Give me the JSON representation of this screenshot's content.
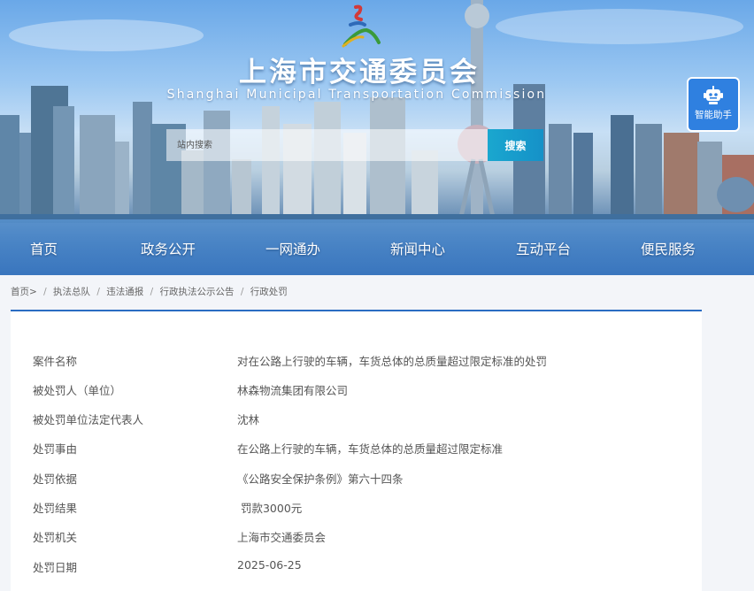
{
  "header": {
    "title": "上海市交通委员会",
    "subtitle": "Shanghai Municipal Transportation Commission",
    "logo_icon": "logo-icon"
  },
  "search": {
    "placeholder": "站内搜索",
    "button_label": "搜索"
  },
  "assistant": {
    "label": "智能助手",
    "icon": "robot-icon"
  },
  "nav": {
    "items": [
      {
        "label": "首页"
      },
      {
        "label": "政务公开"
      },
      {
        "label": "一网通办"
      },
      {
        "label": "新闻中心"
      },
      {
        "label": "互动平台"
      },
      {
        "label": "便民服务"
      }
    ]
  },
  "breadcrumb": {
    "items": [
      {
        "label": "首页>"
      },
      {
        "label": "执法总队"
      },
      {
        "label": "违法通报"
      },
      {
        "label": "行政执法公示公告"
      },
      {
        "label": "行政处罚"
      }
    ],
    "separator": "/"
  },
  "details": {
    "rows": [
      {
        "key": "案件名称",
        "value": "对在公路上行驶的车辆，车货总体的总质量超过限定标准的处罚"
      },
      {
        "key": "被处罚人（单位）",
        "value": "林森物流集团有限公司"
      },
      {
        "key": "被处罚单位法定代表人",
        "value": "沈林"
      },
      {
        "key": "处罚事由",
        "value": "在公路上行驶的车辆，车货总体的总质量超过限定标准"
      },
      {
        "key": "处罚依据",
        "value": "《公路安全保护条例》第六十四条"
      },
      {
        "key": "处罚结果",
        "value": " 罚款3000元"
      },
      {
        "key": "处罚机关",
        "value": "上海市交通委员会"
      },
      {
        "key": "处罚日期",
        "value": "2025-06-25"
      }
    ]
  },
  "colors": {
    "accent": "#2a6cc2",
    "search_button": "#1aa7cf",
    "assistant_bg": "#2f80e0"
  }
}
